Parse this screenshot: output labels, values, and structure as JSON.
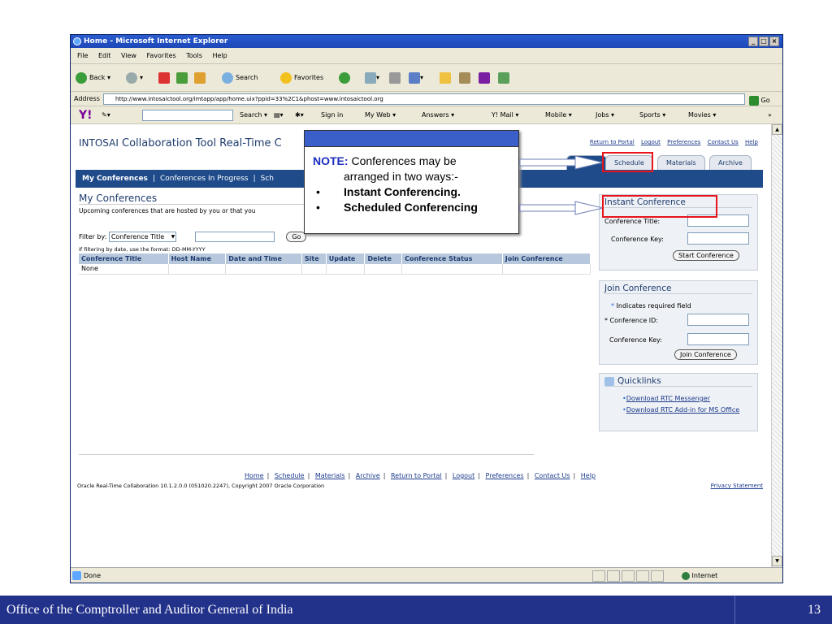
{
  "window": {
    "title": "Home - Microsoft Internet Explorer"
  },
  "menu": [
    "File",
    "Edit",
    "View",
    "Favorites",
    "Tools",
    "Help"
  ],
  "toolbar": {
    "back": "Back",
    "search": "Search",
    "favorites": "Favorites"
  },
  "address": {
    "label": "Address",
    "url": "http://www.intosaictool.org/imtapp/app/home.uix?ppid=33%2C1&phost=www.intosaictool.org",
    "go": "Go"
  },
  "yahoo": {
    "search": "Search",
    "signin": "Sign in",
    "myweb": "My Web",
    "answers": "Answers",
    "mail": "Y! Mail",
    "mobile": "Mobile",
    "jobs": "Jobs",
    "sports": "Sports",
    "movies": "Movies",
    "more": "»"
  },
  "app": {
    "brand": "INTOSAI",
    "title": "Collaboration Tool Real-Time C",
    "top_links": [
      "Return to Portal",
      "Logout",
      "Preferences",
      "Contact Us",
      "Help"
    ],
    "tabs": [
      "Schedule",
      "Materials",
      "Archive"
    ],
    "nav": {
      "current": "My Conferences",
      "in_progress": "Conferences In Progress",
      "sch": "Sch"
    },
    "heading": "My Conferences",
    "subtext": "Upcoming conferences that are hosted by you or that you",
    "filter_label": "Filter by:",
    "filter_option": "Conference Title",
    "go_button": "Go",
    "filter_hint": "If filtering by date, use the format: DD-MM-YYYY",
    "table_headers": [
      "Conference Title",
      "Host Name",
      "Date and Time",
      "Site",
      "Update",
      "Delete",
      "Conference Status",
      "Join Conference"
    ],
    "table_empty": "None",
    "instant": {
      "title": "Instant Conference",
      "conf_title_label": "Conference Title:",
      "conf_key_label": "Conference Key:",
      "button": "Start Conference"
    },
    "join": {
      "title": "Join Conference",
      "required_note": "Indicates required field",
      "required_mark": "*",
      "conf_id_label": "Conference ID:",
      "conf_key_label": "Conference Key:",
      "button": "Join Conference"
    },
    "quicklinks": {
      "title": "Quicklinks",
      "links": [
        "Download RTC Messenger",
        "Download RTC Add-in for MS Office"
      ]
    },
    "footer_links": [
      "Home",
      "Schedule",
      "Materials",
      "Archive",
      "Return to Portal",
      "Logout",
      "Preferences",
      "Contact Us",
      "Help"
    ],
    "copyright": "Oracle Real-Time Collaboration 10.1.2.0.0 (051020.2247), Copyright 2007 Oracle Corporation",
    "privacy": "Privacy Statement"
  },
  "status": {
    "text": "Done",
    "zone": "Internet"
  },
  "callout": {
    "note_label": "NOTE:",
    "line1": "Conferences may be",
    "line2": "arranged in two ways:-",
    "bullets": [
      "Instant Conferencing.",
      "Scheduled Conferencing"
    ]
  },
  "slide_footer": {
    "title": "Office of the Comptroller and Auditor General of India",
    "page": "13"
  }
}
